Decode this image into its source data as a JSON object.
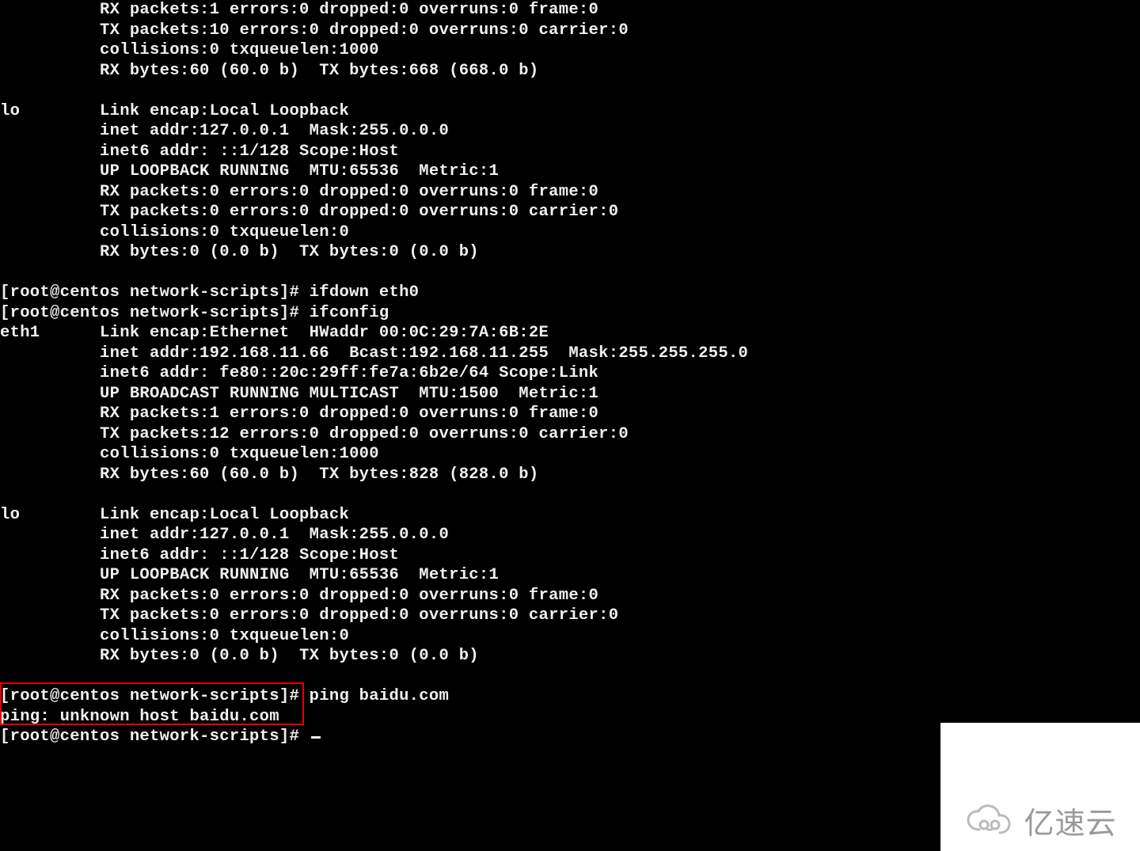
{
  "lines": [
    {
      "indent": 10,
      "text": "RX packets:1 errors:0 dropped:0 overruns:0 frame:0"
    },
    {
      "indent": 10,
      "text": "TX packets:10 errors:0 dropped:0 overruns:0 carrier:0"
    },
    {
      "indent": 10,
      "text": "collisions:0 txqueuelen:1000"
    },
    {
      "indent": 10,
      "text": "RX bytes:60 (60.0 b)  TX bytes:668 (668.0 b)"
    },
    {
      "indent": 0,
      "text": ""
    },
    {
      "indent": 0,
      "iface": "lo",
      "text": "Link encap:Local Loopback"
    },
    {
      "indent": 10,
      "text": "inet addr:127.0.0.1  Mask:255.0.0.0"
    },
    {
      "indent": 10,
      "text": "inet6 addr: ::1/128 Scope:Host"
    },
    {
      "indent": 10,
      "text": "UP LOOPBACK RUNNING  MTU:65536  Metric:1"
    },
    {
      "indent": 10,
      "text": "RX packets:0 errors:0 dropped:0 overruns:0 frame:0"
    },
    {
      "indent": 10,
      "text": "TX packets:0 errors:0 dropped:0 overruns:0 carrier:0"
    },
    {
      "indent": 10,
      "text": "collisions:0 txqueuelen:0"
    },
    {
      "indent": 10,
      "text": "RX bytes:0 (0.0 b)  TX bytes:0 (0.0 b)"
    },
    {
      "indent": 0,
      "text": ""
    },
    {
      "indent": 0,
      "prompt": "[root@centos network-scripts]# ",
      "text": "ifdown eth0"
    },
    {
      "indent": 0,
      "prompt": "[root@centos network-scripts]# ",
      "text": "ifconfig"
    },
    {
      "indent": 0,
      "iface": "eth1",
      "text": "Link encap:Ethernet  HWaddr 00:0C:29:7A:6B:2E"
    },
    {
      "indent": 10,
      "text": "inet addr:192.168.11.66  Bcast:192.168.11.255  Mask:255.255.255.0"
    },
    {
      "indent": 10,
      "text": "inet6 addr: fe80::20c:29ff:fe7a:6b2e/64 Scope:Link"
    },
    {
      "indent": 10,
      "text": "UP BROADCAST RUNNING MULTICAST  MTU:1500  Metric:1"
    },
    {
      "indent": 10,
      "text": "RX packets:1 errors:0 dropped:0 overruns:0 frame:0"
    },
    {
      "indent": 10,
      "text": "TX packets:12 errors:0 dropped:0 overruns:0 carrier:0"
    },
    {
      "indent": 10,
      "text": "collisions:0 txqueuelen:1000"
    },
    {
      "indent": 10,
      "text": "RX bytes:60 (60.0 b)  TX bytes:828 (828.0 b)"
    },
    {
      "indent": 0,
      "text": ""
    },
    {
      "indent": 0,
      "iface": "lo",
      "text": "Link encap:Local Loopback"
    },
    {
      "indent": 10,
      "text": "inet addr:127.0.0.1  Mask:255.0.0.0"
    },
    {
      "indent": 10,
      "text": "inet6 addr: ::1/128 Scope:Host"
    },
    {
      "indent": 10,
      "text": "UP LOOPBACK RUNNING  MTU:65536  Metric:1"
    },
    {
      "indent": 10,
      "text": "RX packets:0 errors:0 dropped:0 overruns:0 frame:0"
    },
    {
      "indent": 10,
      "text": "TX packets:0 errors:0 dropped:0 overruns:0 carrier:0"
    },
    {
      "indent": 10,
      "text": "collisions:0 txqueuelen:0"
    },
    {
      "indent": 10,
      "text": "RX bytes:0 (0.0 b)  TX bytes:0 (0.0 b)"
    },
    {
      "indent": 0,
      "text": ""
    },
    {
      "indent": 0,
      "prompt": "[root@centos network-scripts]# ",
      "text": "ping baidu.com"
    },
    {
      "indent": 0,
      "text": "ping: unknown host baidu.com"
    },
    {
      "indent": 0,
      "prompt": "[root@centos network-scripts]# ",
      "text": "",
      "cursor": true
    }
  ],
  "watermark": {
    "text": "亿速云"
  }
}
